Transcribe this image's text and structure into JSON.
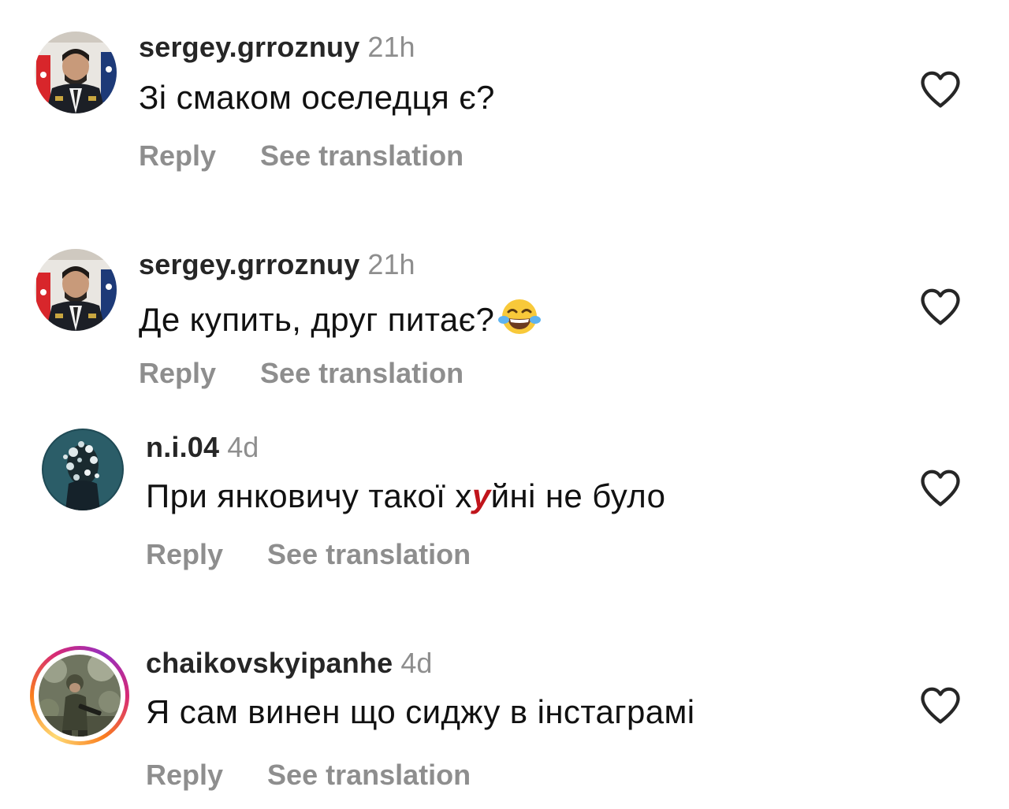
{
  "comments": [
    {
      "username": "sergey.grroznuy",
      "time": "21h",
      "text": "Зі смаком оселедця є?",
      "reply_label": "Reply",
      "translate_label": "See translation",
      "avatar_icon": "avatar-uniformed-man-with-flags"
    },
    {
      "username": "sergey.grroznuy",
      "time": "21h",
      "text": "Де купить, друг питає?",
      "emoji": "face-with-tears-of-joy-emoji",
      "reply_label": "Reply",
      "translate_label": "See translation",
      "avatar_icon": "avatar-uniformed-man-with-flags"
    },
    {
      "username": "n.i.04",
      "time": "4d",
      "text_before": "При янковичу такої х",
      "text_censor": "у",
      "text_after": "йні не було",
      "reply_label": "Reply",
      "translate_label": "See translation",
      "avatar_icon": "avatar-flower-statue"
    },
    {
      "username": "chaikovskyipanhe",
      "time": "4d",
      "text": "Я сам винен що сиджу в інстаграмі",
      "reply_label": "Reply",
      "translate_label": "See translation",
      "avatar_icon": "avatar-soldier-in-forest",
      "story_ring": true
    }
  ],
  "colors": {
    "username": "#262626",
    "secondary": "#8e8e8e",
    "heart_outline": "#262626",
    "censor_mark": "#c0141b"
  }
}
